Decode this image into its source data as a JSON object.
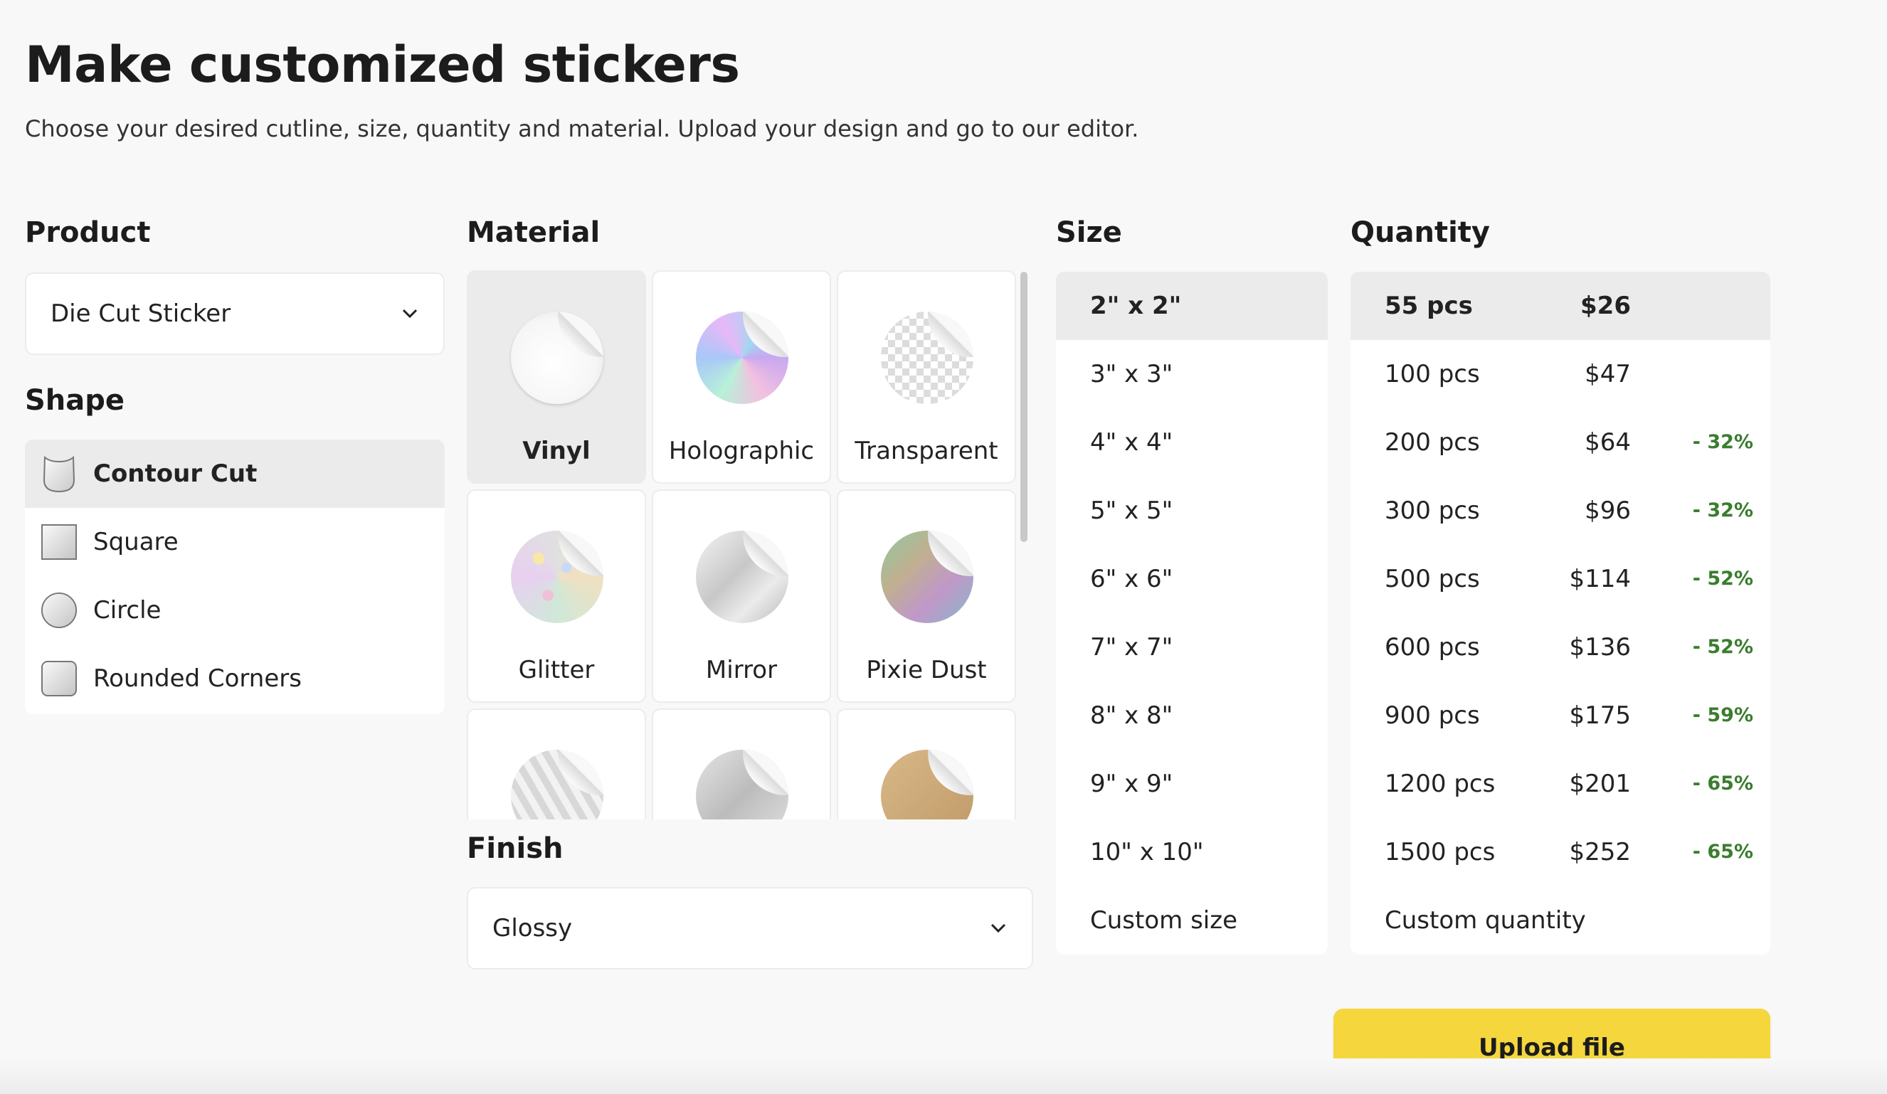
{
  "header": {
    "title": "Make customized stickers",
    "subtitle": "Choose your desired cutline, size, quantity and material. Upload your design and go to our editor."
  },
  "product": {
    "label": "Product",
    "selected": "Die Cut Sticker",
    "icon": "chevron-down-icon"
  },
  "shape": {
    "label": "Shape",
    "items": [
      {
        "label": "Contour Cut",
        "icon": "contour-cut-icon",
        "selected": true
      },
      {
        "label": "Square",
        "icon": "square-icon",
        "selected": false
      },
      {
        "label": "Circle",
        "icon": "circle-icon",
        "selected": false
      },
      {
        "label": "Rounded Corners",
        "icon": "rounded-corners-icon",
        "selected": false
      }
    ]
  },
  "material": {
    "label": "Material",
    "items": [
      {
        "label": "Vinyl",
        "selected": true
      },
      {
        "label": "Holographic",
        "selected": false
      },
      {
        "label": "Transparent",
        "selected": false
      },
      {
        "label": "Glitter",
        "selected": false
      },
      {
        "label": "Mirror",
        "selected": false
      },
      {
        "label": "Pixie Dust",
        "selected": false
      }
    ]
  },
  "finish": {
    "label": "Finish",
    "selected": "Glossy",
    "icon": "chevron-down-icon"
  },
  "size": {
    "label": "Size",
    "items": [
      "2\" x 2\"",
      "3\" x 3\"",
      "4\" x 4\"",
      "5\" x 5\"",
      "6\" x 6\"",
      "7\" x 7\"",
      "8\" x 8\"",
      "9\" x 9\"",
      "10\" x 10\"",
      "Custom size"
    ],
    "selected_index": 0
  },
  "quantity": {
    "label": "Quantity",
    "items": [
      {
        "qty": "55 pcs",
        "price": "$26",
        "discount": ""
      },
      {
        "qty": "100 pcs",
        "price": "$47",
        "discount": ""
      },
      {
        "qty": "200 pcs",
        "price": "$64",
        "discount": "- 32%"
      },
      {
        "qty": "300 pcs",
        "price": "$96",
        "discount": "- 32%"
      },
      {
        "qty": "500 pcs",
        "price": "$114",
        "discount": "- 52%"
      },
      {
        "qty": "600 pcs",
        "price": "$136",
        "discount": "- 52%"
      },
      {
        "qty": "900 pcs",
        "price": "$175",
        "discount": "- 59%"
      },
      {
        "qty": "1200 pcs",
        "price": "$201",
        "discount": "- 65%"
      },
      {
        "qty": "1500 pcs",
        "price": "$252",
        "discount": "- 65%"
      }
    ],
    "custom_label": "Custom quantity",
    "selected_index": 0
  },
  "upload_button": "Upload file",
  "colors": {
    "accent": "#f5d63d",
    "discount": "#3a7d2e",
    "selected_bg": "#ebebeb"
  }
}
